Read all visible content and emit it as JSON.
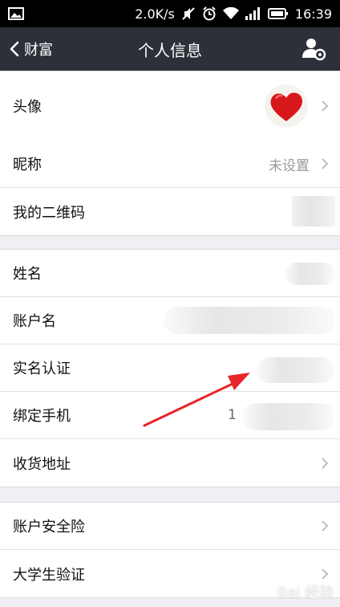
{
  "status_bar": {
    "net_speed": "2.0K/s",
    "time": "16:39",
    "icons": [
      "image-icon",
      "mute-icon",
      "alarm-icon",
      "wifi-icon",
      "signal-icon",
      "battery-icon"
    ]
  },
  "nav": {
    "back_label": "财富",
    "title": "个人信息",
    "action_icon": "user-settings-icon",
    "bg_color": "#2e3039"
  },
  "section1": {
    "avatar_label": "头像"
  },
  "section2": {
    "nickname_label": "昵称",
    "nickname_value": "未设置",
    "qrcode_label": "我的二维码"
  },
  "section3": {
    "name_label": "姓名",
    "account_label": "账户名",
    "realname_label": "实名认证",
    "phone_label": "绑定手机",
    "phone_prefix": "1",
    "address_label": "收货地址"
  },
  "section4": {
    "insurance_label": "账户安全险",
    "student_label": "大学生验证"
  },
  "annotation": {
    "arrow_color": "#e8262a"
  },
  "watermark": "Bai 经验"
}
